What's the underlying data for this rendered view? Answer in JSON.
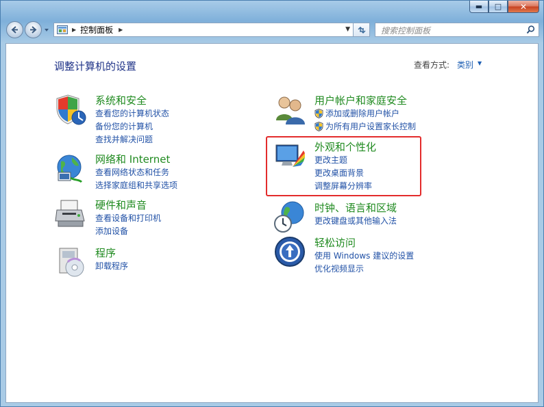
{
  "window": {
    "controls": {
      "minimize": "▬",
      "maximize": "□",
      "close": "✕"
    }
  },
  "address_bar": {
    "path": "控制面板",
    "search_placeholder": "搜索控制面板"
  },
  "header": {
    "title": "调整计算机的设置",
    "view_by_label": "查看方式:",
    "view_by_value": "类别"
  },
  "categories": [
    {
      "icon": "system-security-icon",
      "title": "系统和安全",
      "links": [
        "查看您的计算机状态",
        "备份您的计算机",
        "查找并解决问题"
      ]
    },
    {
      "icon": "network-internet-icon",
      "title": "网络和 Internet",
      "links": [
        "查看网络状态和任务",
        "选择家庭组和共享选项"
      ]
    },
    {
      "icon": "hardware-sound-icon",
      "title": "硬件和声音",
      "links": [
        "查看设备和打印机",
        "添加设备"
      ]
    },
    {
      "icon": "programs-icon",
      "title": "程序",
      "links": [
        "卸载程序"
      ]
    },
    {
      "icon": "user-accounts-icon",
      "title": "用户帐户和家庭安全",
      "links": [
        "添加或删除用户帐户",
        "为所有用户设置家长控制"
      ]
    },
    {
      "icon": "appearance-personalization-icon",
      "title": "外观和个性化",
      "links": [
        "更改主题",
        "更改桌面背景",
        "调整屏幕分辨率"
      ]
    },
    {
      "icon": "clock-language-region-icon",
      "title": "时钟、语言和区域",
      "links": [
        "更改键盘或其他输入法"
      ]
    },
    {
      "icon": "ease-of-access-icon",
      "title": "轻松访问",
      "links": [
        "使用 Windows 建议的设置",
        "优化视频显示"
      ]
    }
  ],
  "colors": {
    "category_title": "#1f8a1f",
    "link": "#2151a6",
    "page_title": "#1e3287",
    "highlight_box": "#e32b2b"
  }
}
